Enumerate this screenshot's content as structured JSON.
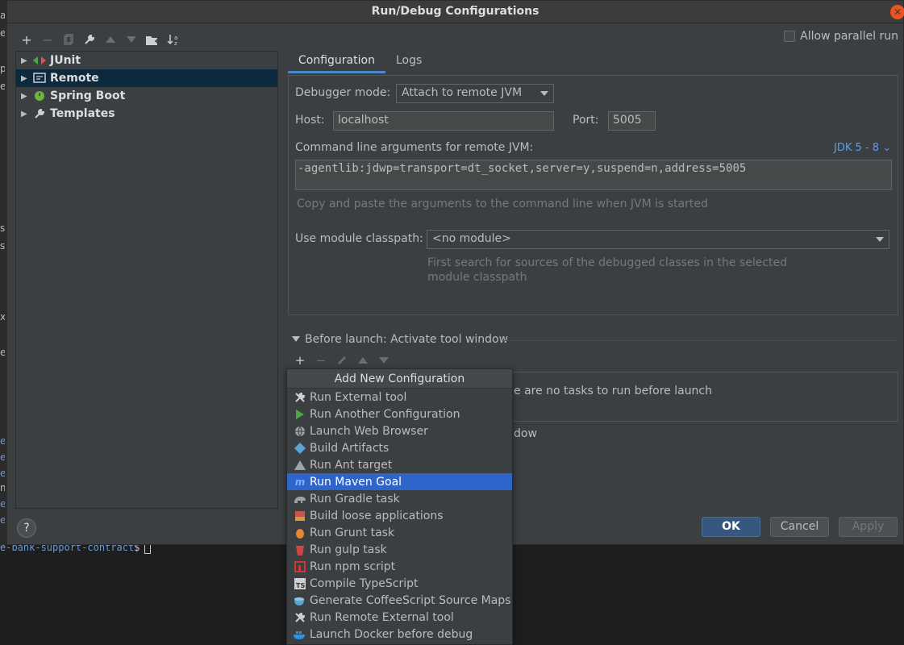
{
  "window": {
    "title": "Run/Debug Configurations"
  },
  "background": {
    "terminal_path": "e-bank-support-contract",
    "terminal_prompt": "$",
    "left_marks": [
      "a",
      "e",
      "p",
      "e",
      "s",
      "s",
      "x",
      "e",
      "e",
      "e",
      "e",
      "m",
      "e",
      "e"
    ]
  },
  "left_toolbar": {
    "add": "+",
    "remove": "−",
    "copy": "⧉",
    "edit": "🔧",
    "up": "▲",
    "down": "▼",
    "folder": "📁",
    "sort": "↓a"
  },
  "tree": {
    "items": [
      {
        "label": "JUnit",
        "icon": "junit-icon"
      },
      {
        "label": "Remote",
        "icon": "remote-icon",
        "selected": true
      },
      {
        "label": "Spring Boot",
        "icon": "spring-boot-icon"
      },
      {
        "label": "Templates",
        "icon": "wrench-icon"
      }
    ]
  },
  "help": "?",
  "allow_parallel_run": {
    "label": "Allow parallel run",
    "checked": false
  },
  "tabs": [
    "Configuration",
    "Logs"
  ],
  "config": {
    "debugger_mode_label": "Debugger mode:",
    "debugger_mode_value": "Attach to remote JVM",
    "host_label": "Host:",
    "host_value": "localhost",
    "port_label": "Port:",
    "port_value": "5005",
    "cmd_label": "Command line arguments for remote JVM:",
    "jdk_link": "JDK 5 - 8 ⌄",
    "cmd_value": "-agentlib:jdwp=transport=dt_socket,server=y,suspend=n,address=5005",
    "cmd_hint": "Copy and paste the arguments to the command line when JVM is started",
    "module_label": "Use module classpath:",
    "module_value": "<no module>",
    "module_hint_1": "First search for sources of the debugged classes in the selected",
    "module_hint_2": "module classpath"
  },
  "before_launch": {
    "title": "Before launch: Activate tool window",
    "empty_text": "e are no tasks to run before launch",
    "extra_text": "dow"
  },
  "buttons": {
    "ok": "OK",
    "cancel": "Cancel",
    "apply": "Apply"
  },
  "popup": {
    "header": "Add New Configuration",
    "items": [
      {
        "label": "Run External tool",
        "icon": "tools-icon"
      },
      {
        "label": "Run Another Configuration",
        "icon": "run-icon"
      },
      {
        "label": "Launch Web Browser",
        "icon": "globe-icon"
      },
      {
        "label": "Build Artifacts",
        "icon": "artifact-icon"
      },
      {
        "label": "Run Ant target",
        "icon": "ant-icon"
      },
      {
        "label": "Run Maven Goal",
        "icon": "maven-icon",
        "selected": true
      },
      {
        "label": "Run Gradle task",
        "icon": "gradle-icon"
      },
      {
        "label": "Build loose applications",
        "icon": "war-icon"
      },
      {
        "label": "Run Grunt task",
        "icon": "grunt-icon"
      },
      {
        "label": "Run gulp task",
        "icon": "gulp-icon"
      },
      {
        "label": "Run npm script",
        "icon": "npm-icon"
      },
      {
        "label": "Compile TypeScript",
        "icon": "typescript-icon"
      },
      {
        "label": "Generate CoffeeScript Source Maps",
        "icon": "coffeescript-icon"
      },
      {
        "label": "Run Remote External tool",
        "icon": "tools-icon"
      },
      {
        "label": "Launch Docker before debug",
        "icon": "docker-icon"
      }
    ]
  },
  "colors": {
    "accent": "#2f65ca",
    "primary_button": "#365880",
    "link": "#589df6",
    "close": "#e95420"
  }
}
